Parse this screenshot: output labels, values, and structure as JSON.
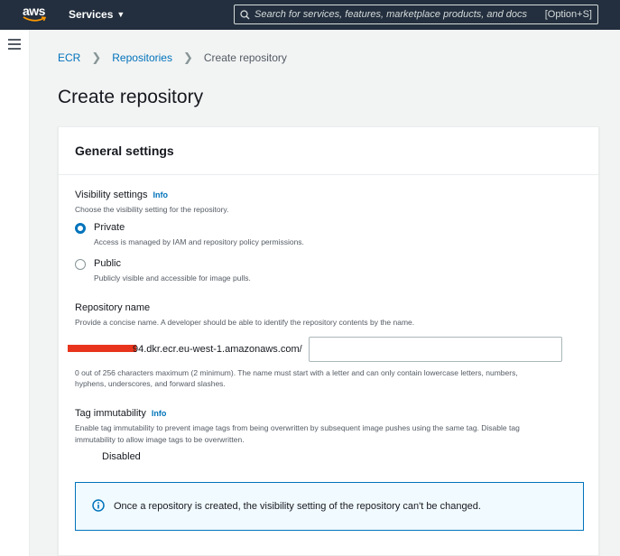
{
  "nav": {
    "logo_text": "aws",
    "services_label": "Services",
    "search_placeholder": "Search for services, features, marketplace products, and docs",
    "search_shortcut": "[Option+S]"
  },
  "breadcrumb": {
    "items": [
      "ECR",
      "Repositories"
    ],
    "current": "Create repository"
  },
  "page": {
    "title": "Create repository"
  },
  "panel": {
    "header": "General settings",
    "visibility": {
      "label": "Visibility settings",
      "info": "Info",
      "description": "Choose the visibility setting for the repository.",
      "options": [
        {
          "label": "Private",
          "description": "Access is managed by IAM and repository policy permissions.",
          "checked": true
        },
        {
          "label": "Public",
          "description": "Publicly visible and accessible for image pulls.",
          "checked": false
        }
      ]
    },
    "repo_name": {
      "label": "Repository name",
      "description": "Provide a concise name. A developer should be able to identify the repository contents by the name.",
      "prefix": "94.dkr.ecr.eu-west-1.amazonaws.com/",
      "value": "",
      "constraint_line1": "0 out of 256 characters maximum (2 minimum). The name must start with a letter and can only contain lowercase letters, numbers,",
      "constraint_line2": "hyphens, underscores, and forward slashes."
    },
    "tag_immutability": {
      "label": "Tag immutability",
      "info": "Info",
      "description_line1": "Enable tag immutability to prevent image tags from being overwritten by subsequent image pushes using the same tag. Disable tag",
      "description_line2": "immutability to allow image tags to be overwritten.",
      "toggle_label": "Disabled"
    },
    "alert": {
      "text": "Once a repository is created, the visibility setting of the repository can't be changed."
    }
  },
  "colors": {
    "nav_bg": "#232f3e",
    "link": "#0073bb",
    "redaction": "#e8341c"
  }
}
